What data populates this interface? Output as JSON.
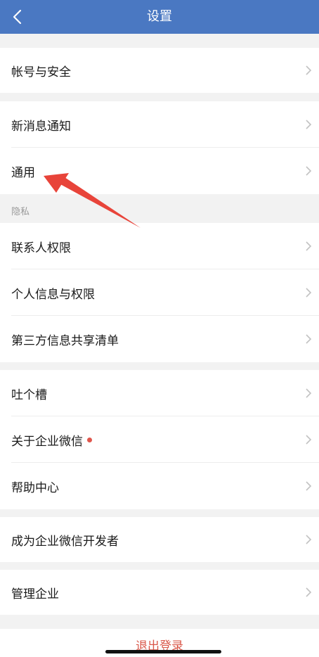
{
  "header": {
    "title": "设置",
    "back_icon": "chevron-left-icon",
    "background_color": "#4a78c2"
  },
  "sections": [
    {
      "items": [
        {
          "label": "帐号与安全"
        }
      ]
    },
    {
      "items": [
        {
          "label": "新消息通知"
        },
        {
          "label": "通用"
        }
      ]
    },
    {
      "title": "隐私",
      "items": [
        {
          "label": "联系人权限"
        },
        {
          "label": "个人信息与权限"
        },
        {
          "label": "第三方信息共享清单"
        }
      ]
    },
    {
      "items": [
        {
          "label": "吐个槽"
        },
        {
          "label": "关于企业微信"
        },
        {
          "label": "帮助中心"
        }
      ]
    },
    {
      "items": [
        {
          "label": "成为企业微信开发者"
        }
      ]
    },
    {
      "items": [
        {
          "label": "管理企业"
        }
      ]
    }
  ],
  "footer": {
    "logout_label": "退出登录",
    "logout_color": "#d9584a"
  },
  "annotation": {
    "arrow_color": "#e8443a",
    "points_to": "通用"
  },
  "badge_color": "#e0564c"
}
